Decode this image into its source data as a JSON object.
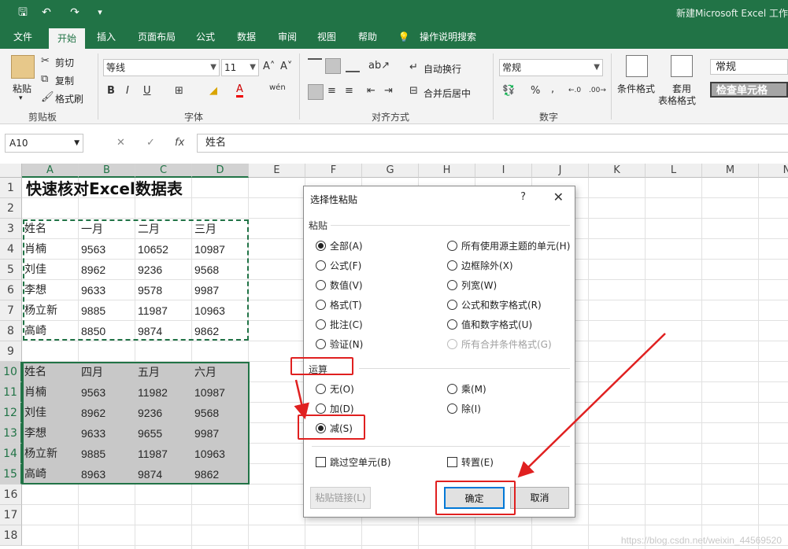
{
  "window": {
    "title": "新建Microsoft Excel 工作",
    "qa_icons": [
      "save-icon",
      "undo-icon",
      "redo-icon",
      "customize-icon"
    ],
    "qa_glyphs": [
      "🖫",
      "↶",
      "↷",
      "▾"
    ]
  },
  "tabs": [
    "文件",
    "开始",
    "插入",
    "页面布局",
    "公式",
    "数据",
    "审阅",
    "视图",
    "帮助",
    "💡",
    "操作说明搜索"
  ],
  "active_tab": "开始",
  "ribbon": {
    "clipboard": {
      "paste": "粘贴",
      "cut": "剪切",
      "copy": "复制",
      "format_painter": "格式刷",
      "label": "剪贴板"
    },
    "font": {
      "name": "等线",
      "size": "11",
      "grow": "A˄",
      "shrink": "A˅",
      "bold": "B",
      "italic": "I",
      "underline": "U",
      "borders": "⊞",
      "fill": "◢",
      "font_color": "A",
      "phonetic": "wén",
      "label": "字体"
    },
    "alignment": {
      "wrap": "自动换行",
      "merge": "合并后居中",
      "label": "对齐方式"
    },
    "number": {
      "format": "常规",
      "percent": "%",
      "comma": ",",
      "label": "数字"
    },
    "styles": {
      "cond_format": "条件格式",
      "table_format_1": "套用",
      "table_format_2": "表格格式",
      "style_normal": "常规",
      "style_check": "检查单元格"
    }
  },
  "formula_bar": {
    "name_box": "A10",
    "cancel": "✕",
    "enter": "✓",
    "fx": "fx",
    "value": "姓名"
  },
  "columns": [
    "A",
    "B",
    "C",
    "D",
    "E",
    "F",
    "G",
    "H",
    "I",
    "J",
    "K",
    "L",
    "M",
    "N"
  ],
  "rows": [
    "1",
    "2",
    "3",
    "4",
    "5",
    "6",
    "7",
    "8",
    "9",
    "10",
    "11",
    "12",
    "13",
    "14",
    "15",
    "16",
    "17",
    "18"
  ],
  "sheet": {
    "title": "快速核对Excel数据表",
    "table1": {
      "headers": [
        "姓名",
        "一月",
        "二月",
        "三月"
      ],
      "rows": [
        [
          "肖楠",
          "9563",
          "10652",
          "10987"
        ],
        [
          "刘佳",
          "8962",
          "9236",
          "9568"
        ],
        [
          "李想",
          "9633",
          "9578",
          "9987"
        ],
        [
          "杨立新",
          "9885",
          "11987",
          "10963"
        ],
        [
          "高崎",
          "8850",
          "9874",
          "9862"
        ]
      ]
    },
    "table2": {
      "headers": [
        "姓名",
        "四月",
        "五月",
        "六月"
      ],
      "rows": [
        [
          "肖楠",
          "9563",
          "11982",
          "10987"
        ],
        [
          "刘佳",
          "8962",
          "9236",
          "9568"
        ],
        [
          "李想",
          "9633",
          "9655",
          "9987"
        ],
        [
          "杨立新",
          "9885",
          "11987",
          "10963"
        ],
        [
          "高崎",
          "8963",
          "9874",
          "9862"
        ]
      ]
    }
  },
  "dialog": {
    "title": "选择性粘贴",
    "help": "?",
    "close": "✕",
    "paste_label": "粘贴",
    "paste_left": [
      "全部(A)",
      "公式(F)",
      "数值(V)",
      "格式(T)",
      "批注(C)",
      "验证(N)"
    ],
    "paste_right": [
      "所有使用源主题的单元(H)",
      "边框除外(X)",
      "列宽(W)",
      "公式和数字格式(R)",
      "值和数字格式(U)",
      "所有合并条件格式(G)"
    ],
    "paste_selected": "全部(A)",
    "operation_label": "运算",
    "op_left": [
      "无(O)",
      "加(D)",
      "减(S)"
    ],
    "op_right": [
      "乘(M)",
      "除(I)"
    ],
    "op_selected": "减(S)",
    "skip_blanks": "跳过空单元(B)",
    "transpose": "转置(E)",
    "paste_link": "粘贴链接(L)",
    "ok": "确定",
    "cancel": "取消"
  },
  "annotation_color": "#e02020",
  "accent": "#217346",
  "watermark": "https://blog.csdn.net/weixin_44569520"
}
